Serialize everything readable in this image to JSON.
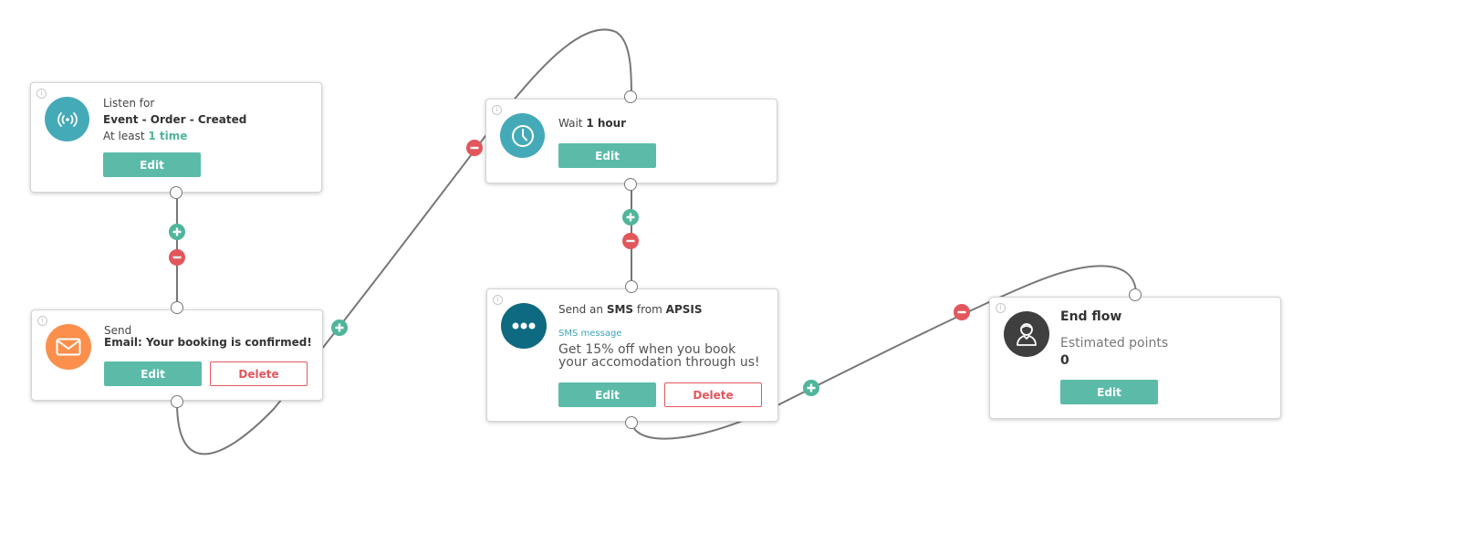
{
  "colors": {
    "accent_green": "#5bbba8",
    "danger_red": "#e2565c",
    "teal": "#45aab8",
    "dark_teal": "#0e6a80",
    "orange": "#fb8f4b",
    "dark_gray": "#3f3f3f",
    "wire": "#777777"
  },
  "nodes": {
    "listen": {
      "icon": "broadcast-icon",
      "line1": "Listen for",
      "event": "Event - Order - Created",
      "freq_prefix": "At least",
      "freq_value": "1 time",
      "edit_label": "Edit",
      "info": "i"
    },
    "email": {
      "icon": "envelope-icon",
      "line1": "Send",
      "subject": "Email: Your booking is confirmed!",
      "edit_label": "Edit",
      "delete_label": "Delete",
      "info": "i"
    },
    "wait": {
      "icon": "clock-icon",
      "prefix": "Wait",
      "duration": "1 hour",
      "edit_label": "Edit",
      "info": "i"
    },
    "sms": {
      "icon": "chat-bubble-icon",
      "prefix": "Send an",
      "channel": "SMS",
      "mid": "from",
      "sender": "APSIS",
      "message_label": "SMS message",
      "message": "Get 15% off when you book your accomodation through us!",
      "edit_label": "Edit",
      "delete_label": "Delete",
      "info": "i"
    },
    "end": {
      "icon": "user-icon",
      "title": "End flow",
      "points_label": "Estimated points",
      "points_value": "0",
      "edit_label": "Edit",
      "info": "i"
    }
  },
  "controls": {
    "plus_symbol": "+",
    "minus_symbol": "−"
  }
}
